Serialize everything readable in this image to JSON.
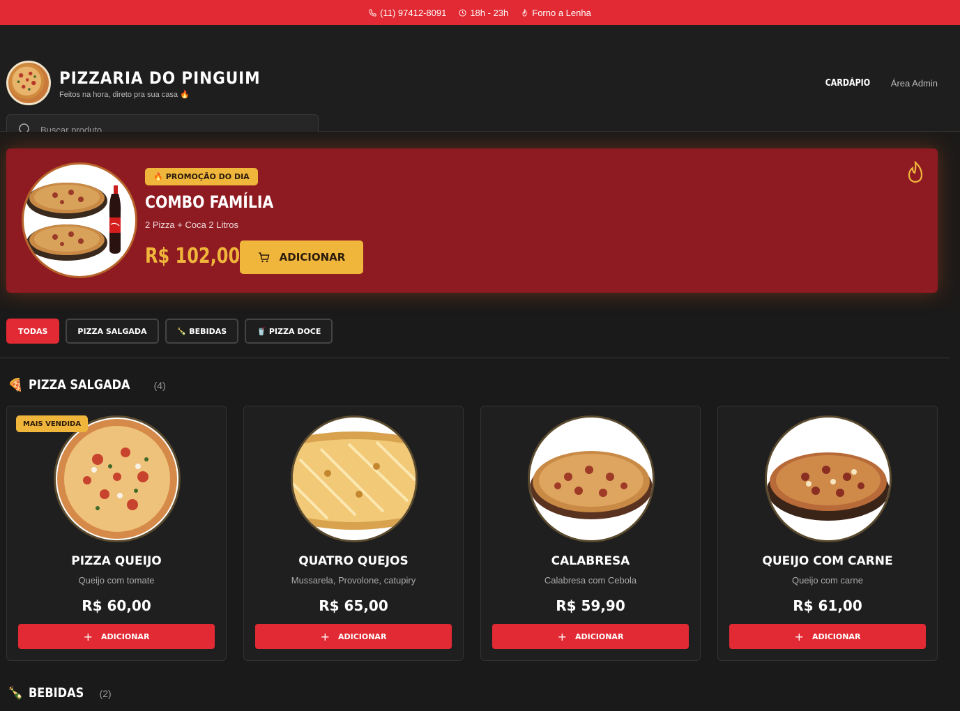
{
  "topbar": {
    "phone": "(11) 97412-8091",
    "hours": "18h - 23h",
    "feature": "Forno a Lenha"
  },
  "header": {
    "title": "PIZZARIA DO PINGUIM",
    "subtitle": "Feitos na hora, direto pra sua casa 🔥",
    "nav": {
      "menu": "CARDÁPIO",
      "admin": "Área Admin"
    },
    "search_placeholder": "Buscar produto..."
  },
  "promo": {
    "badge": "PROMOÇÃO DO DIA",
    "title": "COMBO FAMÍLIA",
    "description": "2 Pizza + Coca 2 Litros",
    "price": "R$ 102,00",
    "button": "ADICIONAR"
  },
  "filters": [
    "TODAS",
    "PIZZA SALGADA",
    "BEBIDAS",
    "PIZZA DOCE"
  ],
  "sections": {
    "salgada": {
      "name": "PIZZA SALGADA",
      "count": "(4)"
    },
    "bebidas": {
      "name": "BEBIDAS",
      "count": "(2)"
    }
  },
  "products": [
    {
      "badge": "MAIS VENDIDA",
      "name": "PIZZA QUEIJO",
      "description": "Queijo com tomate",
      "price": "R$ 60,00",
      "button": "ADICIONAR"
    },
    {
      "badge": "",
      "name": "QUATRO QUEJOS",
      "description": "Mussarela, Provolone, catupiry",
      "price": "R$ 65,00",
      "button": "ADICIONAR"
    },
    {
      "badge": "",
      "name": "CALABRESA",
      "description": "Calabresa com Cebola",
      "price": "R$ 59,90",
      "button": "ADICIONAR"
    },
    {
      "badge": "",
      "name": "QUEIJO COM CARNE",
      "description": "Queijo com carne",
      "price": "R$ 61,00",
      "button": "ADICIONAR"
    }
  ],
  "colors": {
    "accent": "#e12a33",
    "gold": "#f0b63c",
    "promo_bg": "#8e1a22",
    "background": "#1a1a1a"
  }
}
